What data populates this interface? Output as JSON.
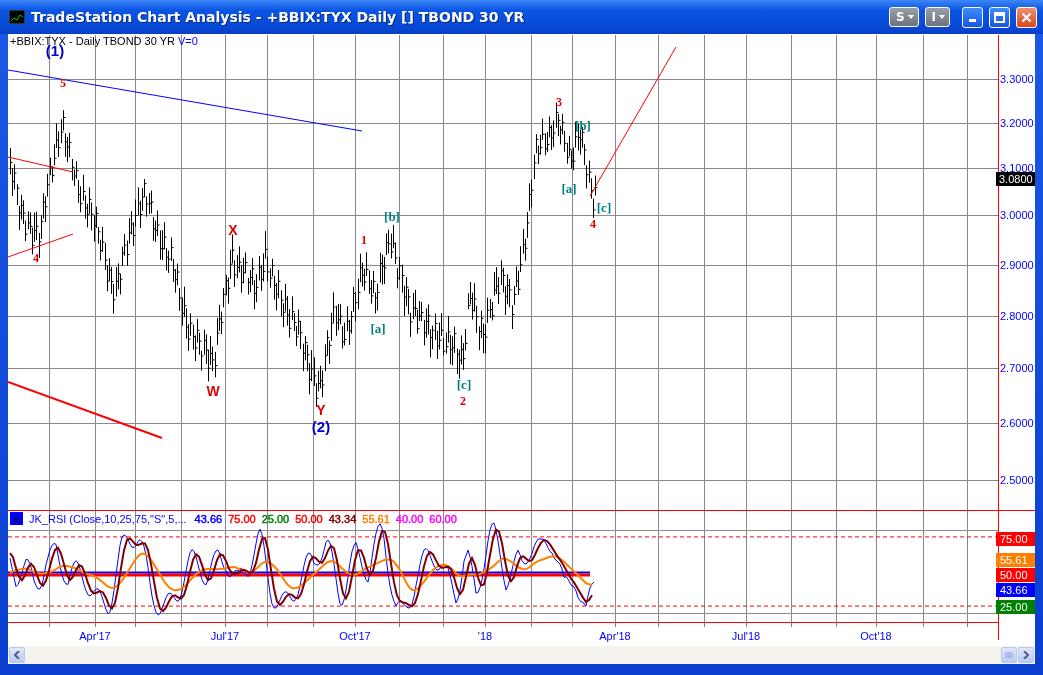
{
  "window": {
    "title": "TradeStation Chart Analysis - +BBIX:TYX Daily [] TBOND 30 YR",
    "menu_buttons": [
      "S",
      "I"
    ]
  },
  "price_pane": {
    "legend": "+BBIX:TYX - Daily  TBOND 30 YR",
    "volume": "V=0",
    "y_axis_labels": [
      "3.3000",
      "3.2000",
      "3.1000",
      "3.0000",
      "2.9000",
      "2.8000",
      "2.7000",
      "2.6000",
      "2.5000"
    ],
    "last_price": "3.0800",
    "wave_labels": [
      {
        "text": "(1)",
        "kind": "intermediate",
        "color": "#0000cc"
      },
      {
        "text": "5",
        "kind": "minor",
        "color": "#e00000"
      },
      {
        "text": "4",
        "kind": "minor",
        "color": "#e00000"
      },
      {
        "text": "X",
        "kind": "primary",
        "color": "#e00000"
      },
      {
        "text": "W",
        "kind": "primary",
        "color": "#e00000"
      },
      {
        "text": "Y",
        "kind": "primary",
        "color": "#e00000"
      },
      {
        "text": "(2)",
        "kind": "intermediate",
        "color": "#0000cc"
      },
      {
        "text": "1",
        "kind": "minor",
        "color": "#e00000"
      },
      {
        "text": "[b]",
        "kind": "minute",
        "color": "#008080"
      },
      {
        "text": "[a]",
        "kind": "minute",
        "color": "#008080"
      },
      {
        "text": "[c]",
        "kind": "minute",
        "color": "#008080"
      },
      {
        "text": "2",
        "kind": "minor",
        "color": "#e00000"
      },
      {
        "text": "3",
        "kind": "minor",
        "color": "#e00000"
      },
      {
        "text": "[b]",
        "kind": "minute",
        "color": "#008080"
      },
      {
        "text": "[a]",
        "kind": "minute",
        "color": "#008080"
      },
      {
        "text": "[c]",
        "kind": "minute",
        "color": "#008080"
      },
      {
        "text": "4",
        "kind": "minor",
        "color": "#e00000"
      }
    ]
  },
  "indicator_pane": {
    "legend": "JK_RSI (Close,10,25,75,\"S\",5,...",
    "values": [
      {
        "text": "43.66",
        "color": "#0000ff"
      },
      {
        "text": "75.00",
        "color": "#ff0000"
      },
      {
        "text": "25.00",
        "color": "#008000"
      },
      {
        "text": "50.00",
        "color": "#ff0000"
      },
      {
        "text": "43.34",
        "color": "#800000"
      },
      {
        "text": "55.61",
        "color": "#ff8000"
      },
      {
        "text": "40.00",
        "color": "#ff00ff"
      },
      {
        "text": "60.00",
        "color": "#ff00ff"
      }
    ],
    "level_badges": [
      {
        "text": "75.00",
        "color": "#ff0000"
      },
      {
        "text": "55.61",
        "color": "#ff8000"
      },
      {
        "text": "50.00",
        "color": "#ff0000"
      },
      {
        "text": "43.66",
        "color": "#0000ff"
      },
      {
        "text": "25.00",
        "color": "#008000"
      }
    ]
  },
  "time_axis": [
    "Apr'17",
    "Jul'17",
    "Oct'17",
    "'18",
    "Apr'18",
    "Jul'18",
    "Oct'18"
  ]
}
